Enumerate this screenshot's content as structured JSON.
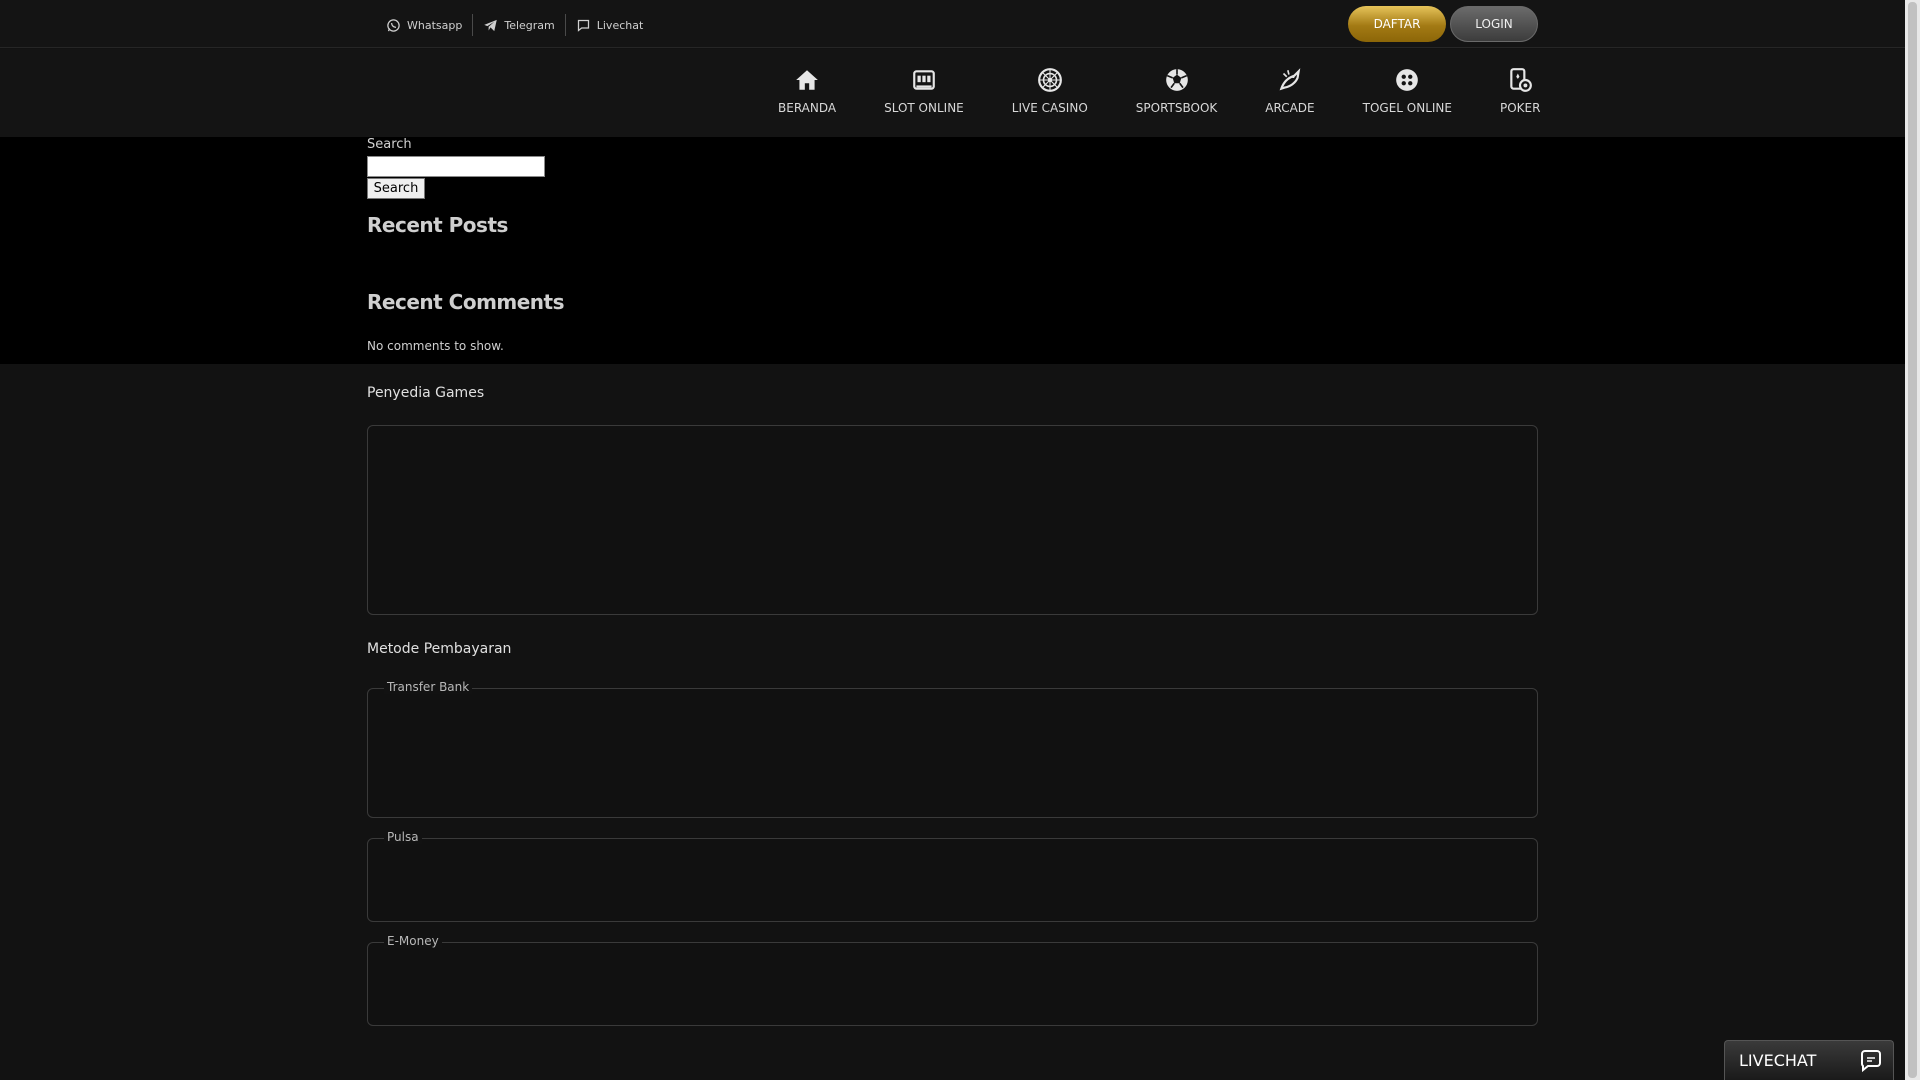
{
  "topbar": {
    "contacts": [
      {
        "label": "Whatsapp",
        "icon": "whatsapp-icon"
      },
      {
        "label": "Telegram",
        "icon": "telegram-icon"
      },
      {
        "label": "Livechat",
        "icon": "chat-bubble-icon"
      }
    ],
    "daftar_label": "DAFTAR",
    "login_label": "LOGIN"
  },
  "nav": [
    {
      "label": "BERANDA",
      "icon": "home-icon"
    },
    {
      "label": "SLOT ONLINE",
      "icon": "slot-machine-icon"
    },
    {
      "label": "LIVE CASINO",
      "icon": "roulette-icon"
    },
    {
      "label": "SPORTSBOOK",
      "icon": "soccer-ball-icon"
    },
    {
      "label": "ARCADE",
      "icon": "fish-icon"
    },
    {
      "label": "TOGEL ONLINE",
      "icon": "lottery-ball-icon"
    },
    {
      "label": "POKER",
      "icon": "poker-icon"
    }
  ],
  "sidebar": {
    "search_label": "Search",
    "search_value": "",
    "search_button": "Search",
    "recent_posts_title": "Recent Posts",
    "recent_comments_title": "Recent Comments",
    "no_comments": "No comments to show."
  },
  "footer": {
    "providers_title": "Penyedia Games",
    "payment_title": "Metode Pembayaran",
    "payment_groups": [
      "Transfer Bank",
      "Pulsa",
      "E-Money"
    ]
  },
  "livechat": {
    "label": "LIVECHAT",
    "icon": "chat-icon"
  },
  "colors": {
    "background": "#121212",
    "widget_bg": "#000000",
    "gold": "#c9a23a"
  }
}
